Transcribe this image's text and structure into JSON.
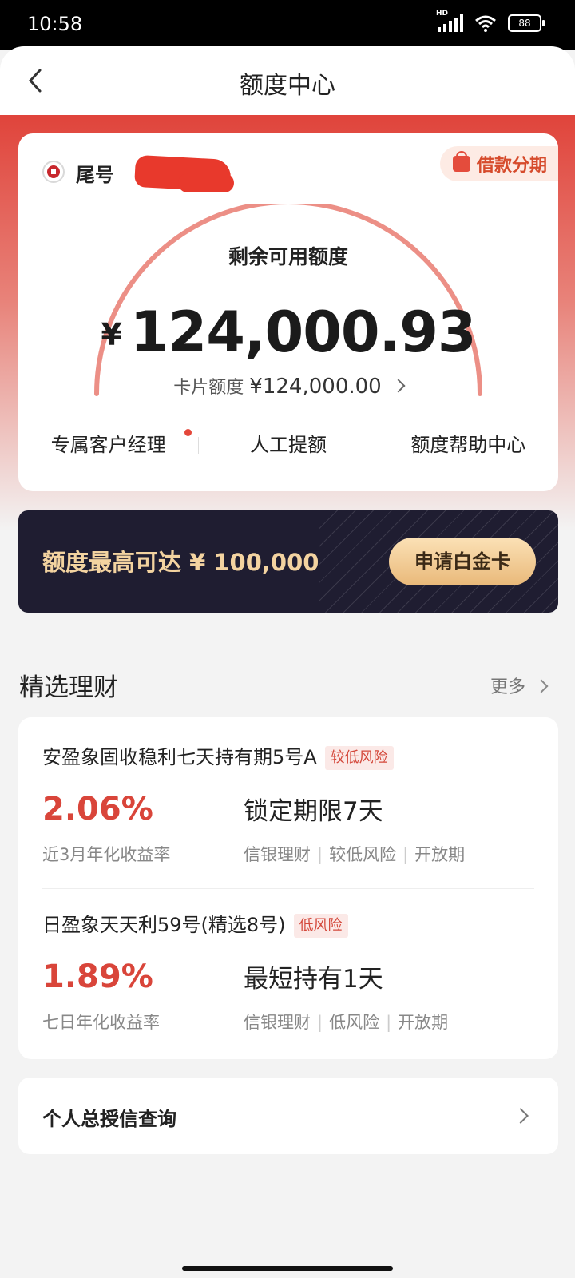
{
  "status_bar": {
    "time": "10:58",
    "network_label": "HD",
    "battery": "88"
  },
  "header": {
    "title": "额度中心"
  },
  "credit_card": {
    "tail_label": "尾号",
    "loan_badge": "借款分期",
    "available_label": "剩余可用额度",
    "currency_symbol": "¥",
    "available_amount": "124,000.93",
    "card_limit_label": "卡片额度",
    "card_limit_value": "¥124,000.00",
    "quick_links": [
      "专属客户经理",
      "人工提额",
      "额度帮助中心"
    ]
  },
  "platinum": {
    "text": "额度最高可达 ¥ 100,000",
    "button": "申请白金卡"
  },
  "wealth": {
    "title": "精选理财",
    "more": "更多",
    "products": [
      {
        "name": "安盈象固收稳利七天持有期5号A",
        "risk": "较低风险",
        "rate": "2.06%",
        "rate_label": "近3月年化收益率",
        "term": "锁定期限7天",
        "tags": [
          "信银理财",
          "较低风险",
          "开放期"
        ]
      },
      {
        "name": "日盈象天天利59号(精选8号)",
        "risk": "低风险",
        "rate": "1.89%",
        "rate_label": "七日年化收益率",
        "term": "最短持有1天",
        "tags": [
          "信银理财",
          "低风险",
          "开放期"
        ]
      }
    ]
  },
  "credit_query": {
    "label": "个人总授信查询"
  },
  "colors": {
    "accent_red": "#e0443b",
    "rate_red": "#d9453a",
    "banner_dark": "#1f1d31",
    "banner_gold": "#f3d3a0"
  }
}
